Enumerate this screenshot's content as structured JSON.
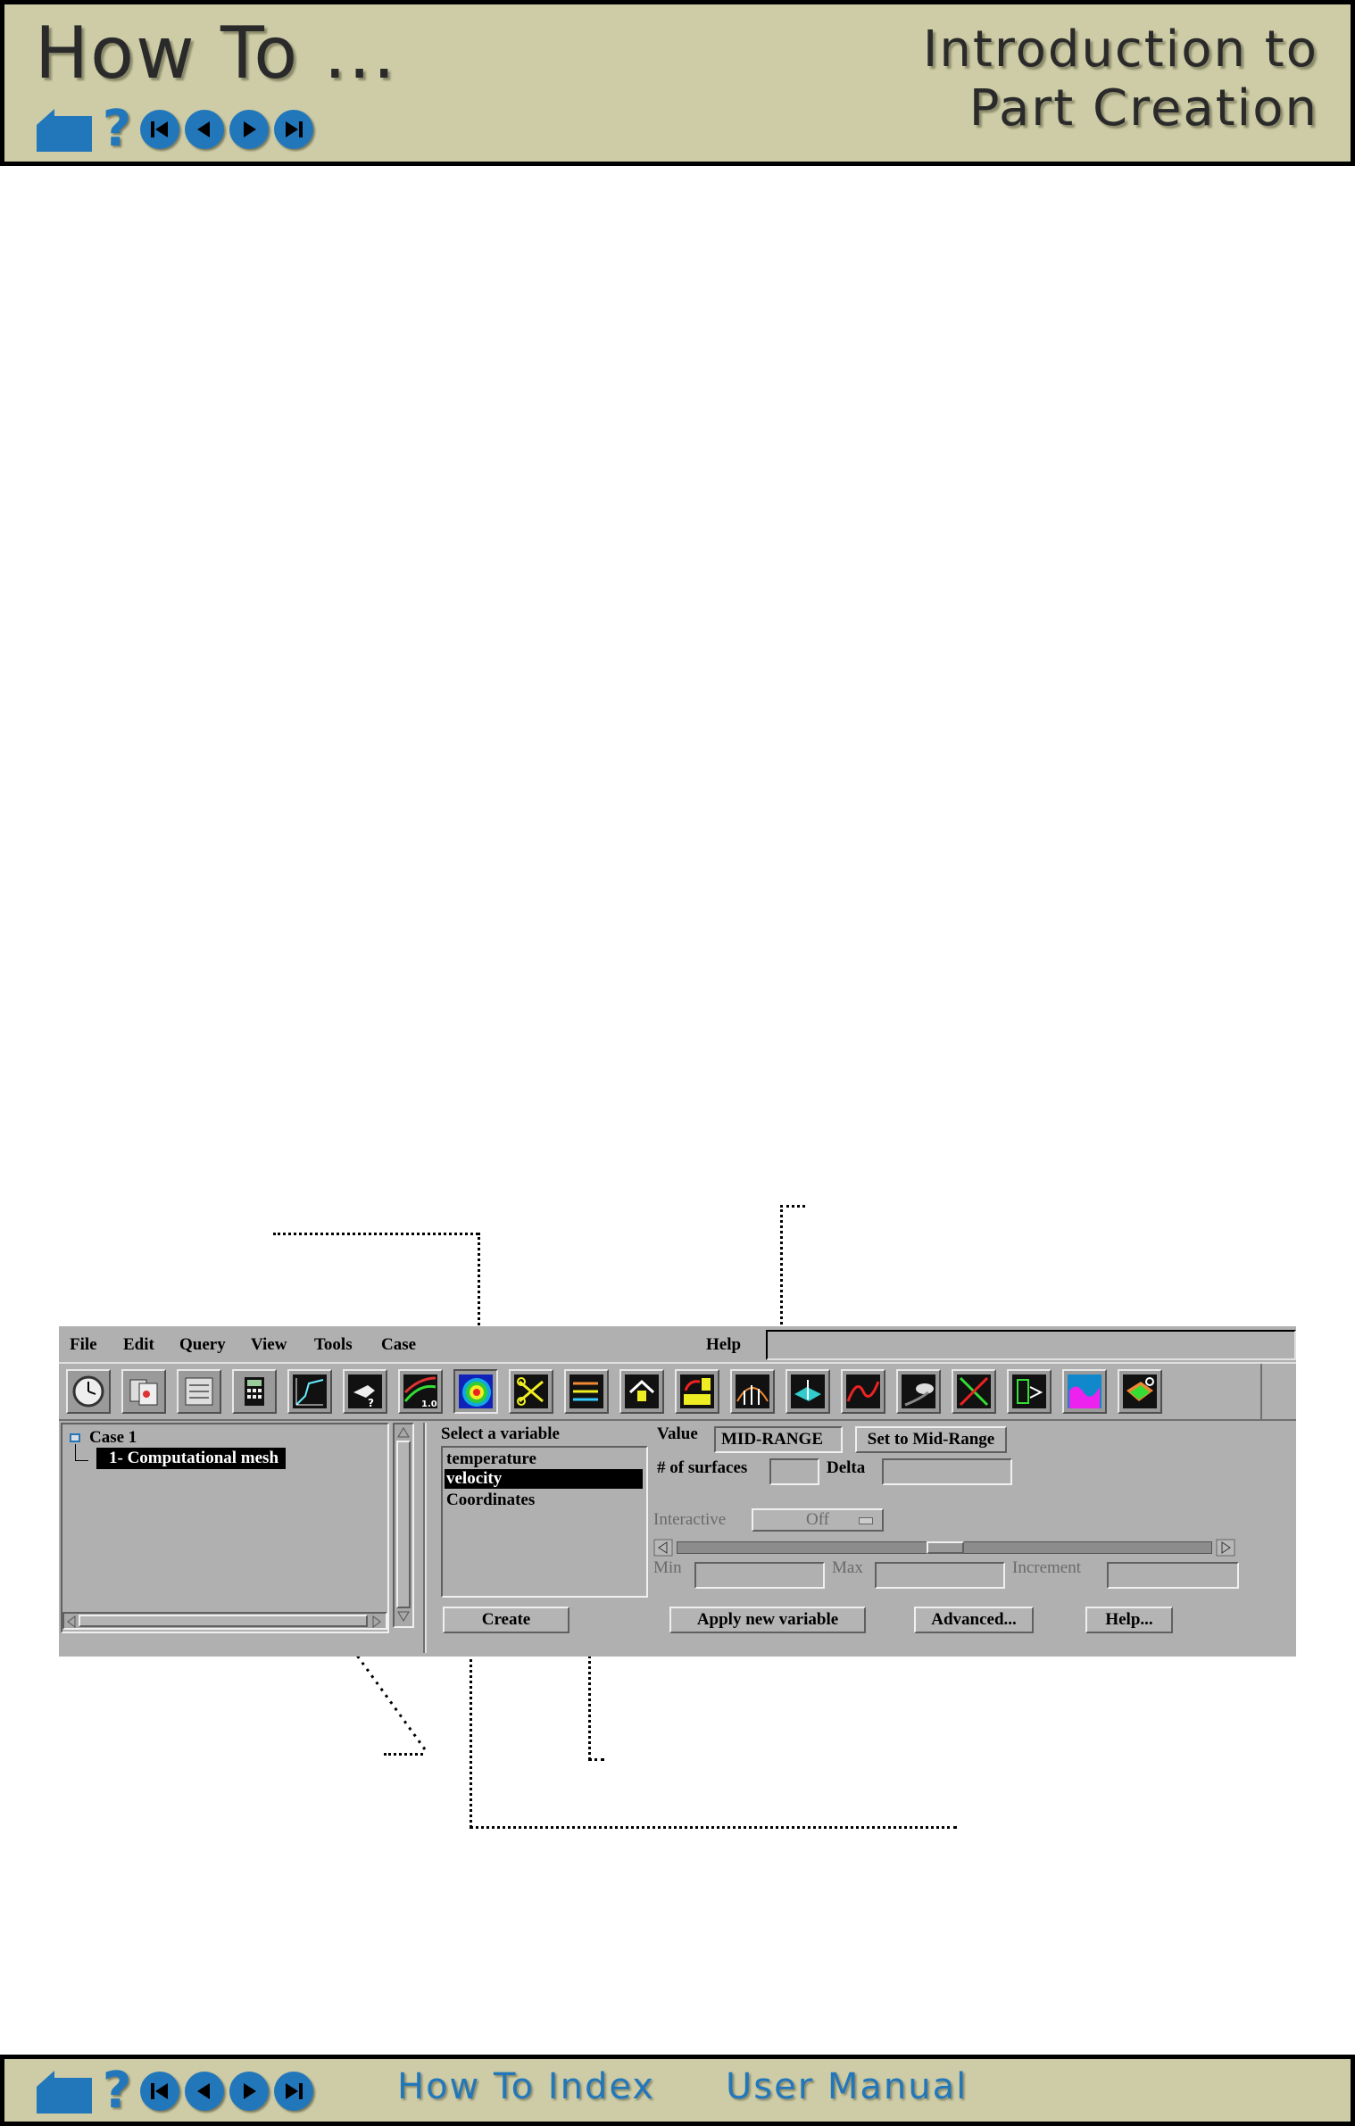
{
  "header": {
    "title": "How To ...",
    "subtitle_line1": "Introduction to",
    "subtitle_line2": "Part Creation",
    "nav_icons": [
      "home-icon",
      "help-icon",
      "first-page-icon",
      "previous-page-icon",
      "next-page-icon",
      "last-page-icon"
    ]
  },
  "footer": {
    "links": [
      "How To Index",
      "User Manual"
    ]
  },
  "app": {
    "menu": [
      "File",
      "Edit",
      "Query",
      "View",
      "Tools",
      "Case"
    ],
    "help_menu": "Help",
    "toolbar_icons": [
      "clock-icon",
      "file-cards-icon",
      "parts-list-icon",
      "calculator-icon",
      "plot-icon",
      "query-hand-icon",
      "isovalue-line-icon",
      "isosurface-contour-icon",
      "scissors-clip-icon",
      "vector-arrows-icon",
      "house-elevate-icon",
      "numbered-blocks-icon",
      "profile-bars-icon",
      "sheet-arrow-icon",
      "red-curve-icon",
      "particle-trace-icon",
      "separation-icon",
      "tensor-icon",
      "magenta-wave-icon",
      "develop-icon"
    ],
    "part_tree": {
      "case_label": "Case 1",
      "part_label": "1- Computational mesh"
    },
    "variable_panel": {
      "title": "Select a variable",
      "variables": [
        "temperature",
        "velocity",
        "Coordinates"
      ],
      "selected_index": 1
    },
    "value_label": "Value",
    "value_field": "MID-RANGE",
    "set_midrange_button": "Set to Mid-Range",
    "surfaces_label": "# of surfaces",
    "surfaces_value": "",
    "delta_label": "Delta",
    "delta_value": "",
    "interactive_label": "Interactive",
    "interactive_value": "Off",
    "min_label": "Min",
    "max_label": "Max",
    "increment_label": "Increment",
    "create_button": "Create",
    "apply_button": "Apply new variable",
    "advanced_button": "Advanced...",
    "help_button": "Help..."
  },
  "colors": {
    "bar_background": "#cdcca6",
    "nav_blue": "#2277bb",
    "panel_gray": "#b0b0b0"
  }
}
